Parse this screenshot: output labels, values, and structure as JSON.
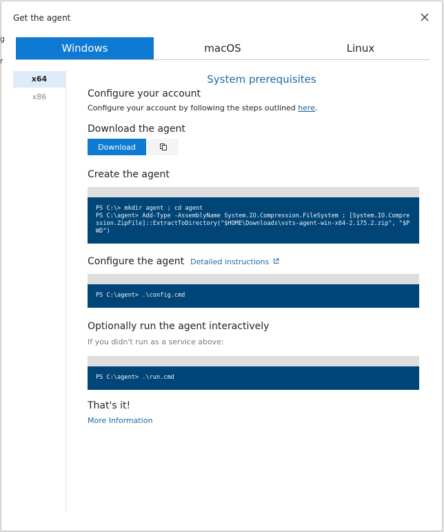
{
  "dialog": {
    "title": "Get the agent",
    "edge_fragments": [
      "g",
      "r"
    ]
  },
  "tabs": [
    {
      "label": "Windows"
    },
    {
      "label": "macOS"
    },
    {
      "label": "Linux"
    }
  ],
  "archs": [
    {
      "label": "x64"
    },
    {
      "label": "x86"
    }
  ],
  "prereq_link": "System prerequisites",
  "configure_account": {
    "heading": "Configure your account",
    "text": "Configure your account by following the steps outlined ",
    "link": "here",
    "suffix": "."
  },
  "download": {
    "heading": "Download the agent",
    "button": "Download"
  },
  "create": {
    "heading": "Create the agent",
    "code": "PS C:\\> mkdir agent ; cd agent\nPS C:\\agent> Add-Type -AssemblyName System.IO.Compression.FileSystem ; [System.IO.Compression.ZipFile]::ExtractToDirectory(\"$HOME\\Downloads\\vsts-agent-win-x64-2.175.2.zip\", \"$PWD\")"
  },
  "configure_agent": {
    "heading": "Configure the agent",
    "link": "Detailed instructions",
    "code": "PS C:\\agent> .\\config.cmd"
  },
  "run": {
    "heading": "Optionally run the agent interactively",
    "note": "If you didn't run as a service above:",
    "code": "PS C:\\agent> .\\run.cmd"
  },
  "done": {
    "heading": "That's it!",
    "link": "More Information"
  }
}
